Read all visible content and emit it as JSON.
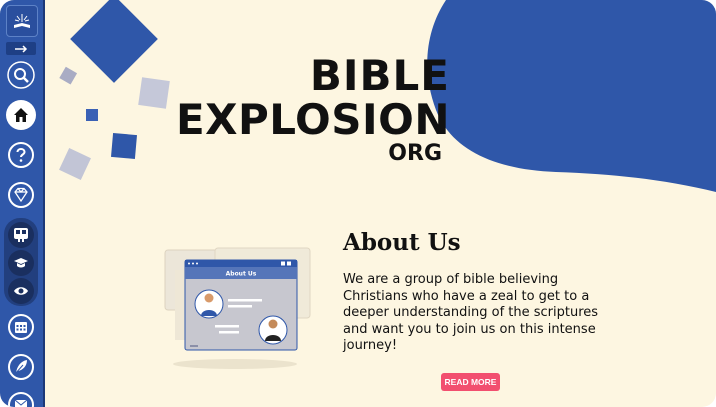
{
  "brand": {
    "title_line1": "BIBLE",
    "title_line2": "EXPLOSION",
    "title_line3": "ORG"
  },
  "sidebar": {
    "items": [
      {
        "icon": "logo-book-icon"
      },
      {
        "icon": "arrow-right-icon"
      },
      {
        "icon": "search-icon"
      },
      {
        "icon": "home-icon",
        "active": true
      },
      {
        "icon": "question-icon"
      },
      {
        "icon": "gem-icon"
      },
      {
        "icon": "slides-icon"
      },
      {
        "icon": "graduation-cap-icon"
      },
      {
        "icon": "eye-icon"
      },
      {
        "icon": "calendar-icon"
      },
      {
        "icon": "feather-icon"
      },
      {
        "icon": "mail-icon"
      }
    ]
  },
  "about": {
    "heading": "About Us",
    "body": "We are a group of bible believing Christians who have a zeal to get to a deeper understanding of the scriptures and want you to join us on this intense journey!",
    "button_label": "READ MORE"
  },
  "illustration": {
    "window_title": "About Us"
  },
  "colors": {
    "accent_blue": "#2f57a9",
    "background": "#fdf6e1",
    "button_pink": "#f24f6f"
  }
}
